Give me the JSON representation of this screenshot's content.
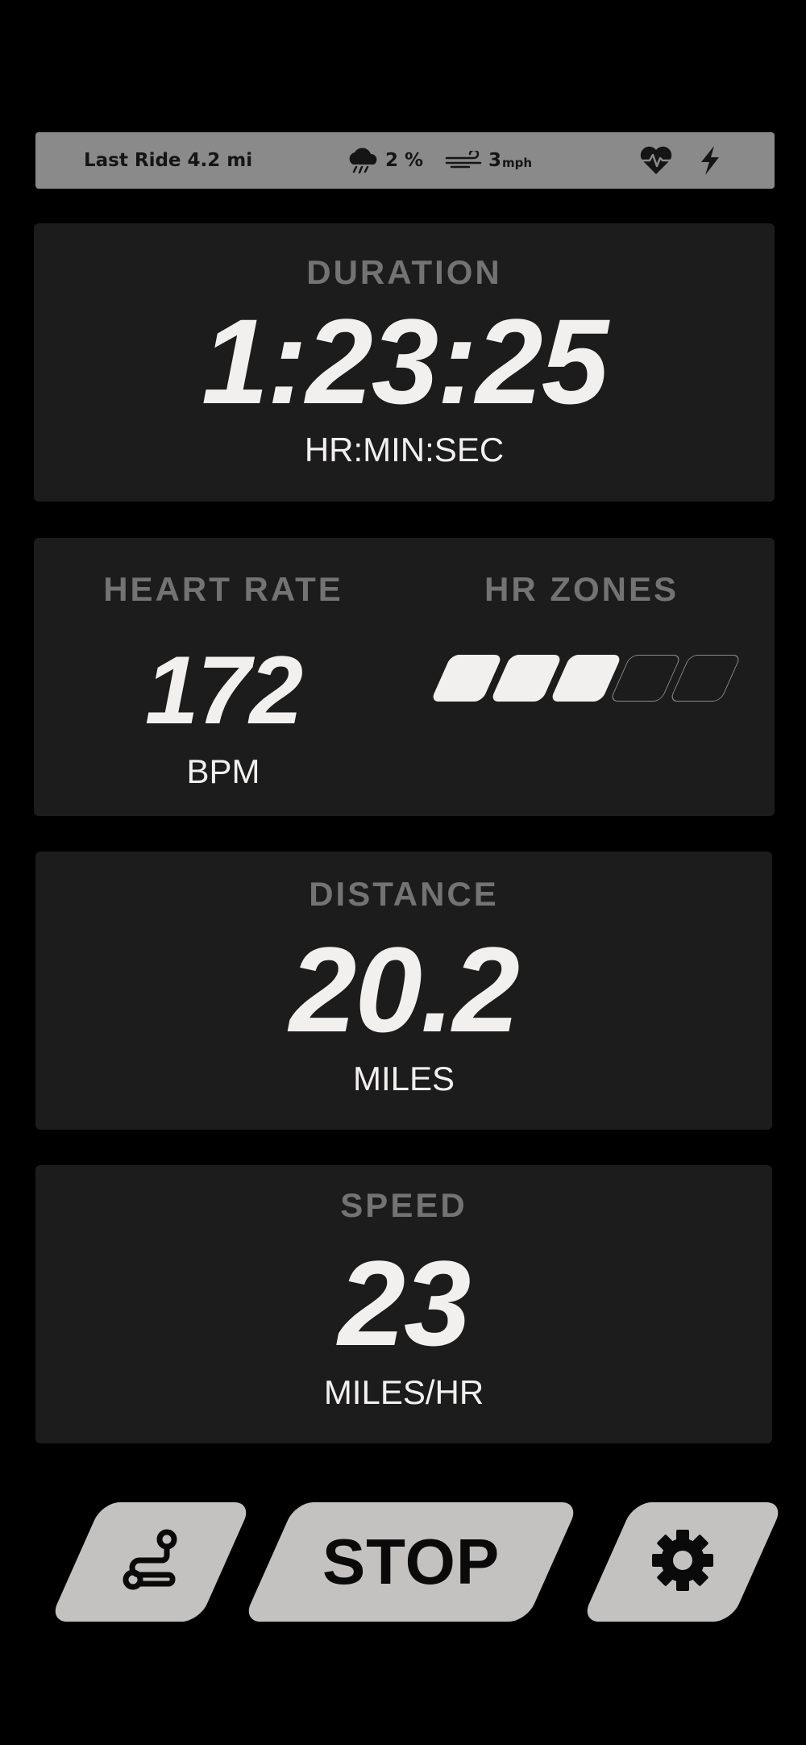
{
  "status_bar": {
    "last_ride": "Last Ride 4.2 mi",
    "rain_percent": "2 %",
    "wind_speed": "3",
    "wind_unit": "mph",
    "icons": [
      "rain-cloud-icon",
      "wind-icon",
      "heart-pulse-icon",
      "lightning-icon"
    ]
  },
  "duration": {
    "label": "DURATION",
    "value": "1:23:25",
    "unit": "HR:MIN:SEC"
  },
  "heart_rate": {
    "label": "HEART RATE",
    "value": "172",
    "unit": "BPM"
  },
  "hr_zones": {
    "label": "HR ZONES",
    "total": 5,
    "filled": 3
  },
  "distance": {
    "label": "DISTANCE",
    "value": "20.2",
    "unit": "MILES"
  },
  "speed": {
    "label": "SPEED",
    "value": "23",
    "unit": "MILES/HR"
  },
  "controls": {
    "route_icon": "route-icon",
    "stop_label": "STOP",
    "settings_icon": "gear-icon"
  },
  "colors": {
    "background": "#000000",
    "card": "#1c1c1c",
    "status_bar": "#8a8a8a",
    "label": "#737373",
    "value": "#f2f0ef",
    "button": "#c4c2c1"
  }
}
